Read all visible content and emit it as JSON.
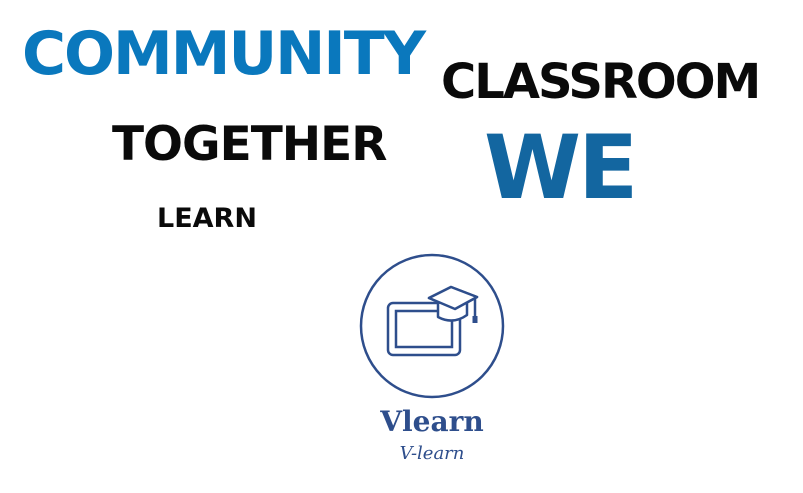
{
  "word_cloud": {
    "words": {
      "community": "COMMUNITY",
      "classroom": "CLASSROOM",
      "together": "TOGETHER",
      "we": "WE",
      "learn": "LEARN"
    }
  },
  "logo": {
    "icon": "tablet-with-graduation-cap-icon",
    "name": "Vlearn",
    "tagline": "V-learn"
  },
  "colors": {
    "brand_blue": "#0a78bd",
    "we_blue": "#1366a0",
    "logo_navy": "#2e4e8c",
    "text_black": "#0a0a0a"
  }
}
